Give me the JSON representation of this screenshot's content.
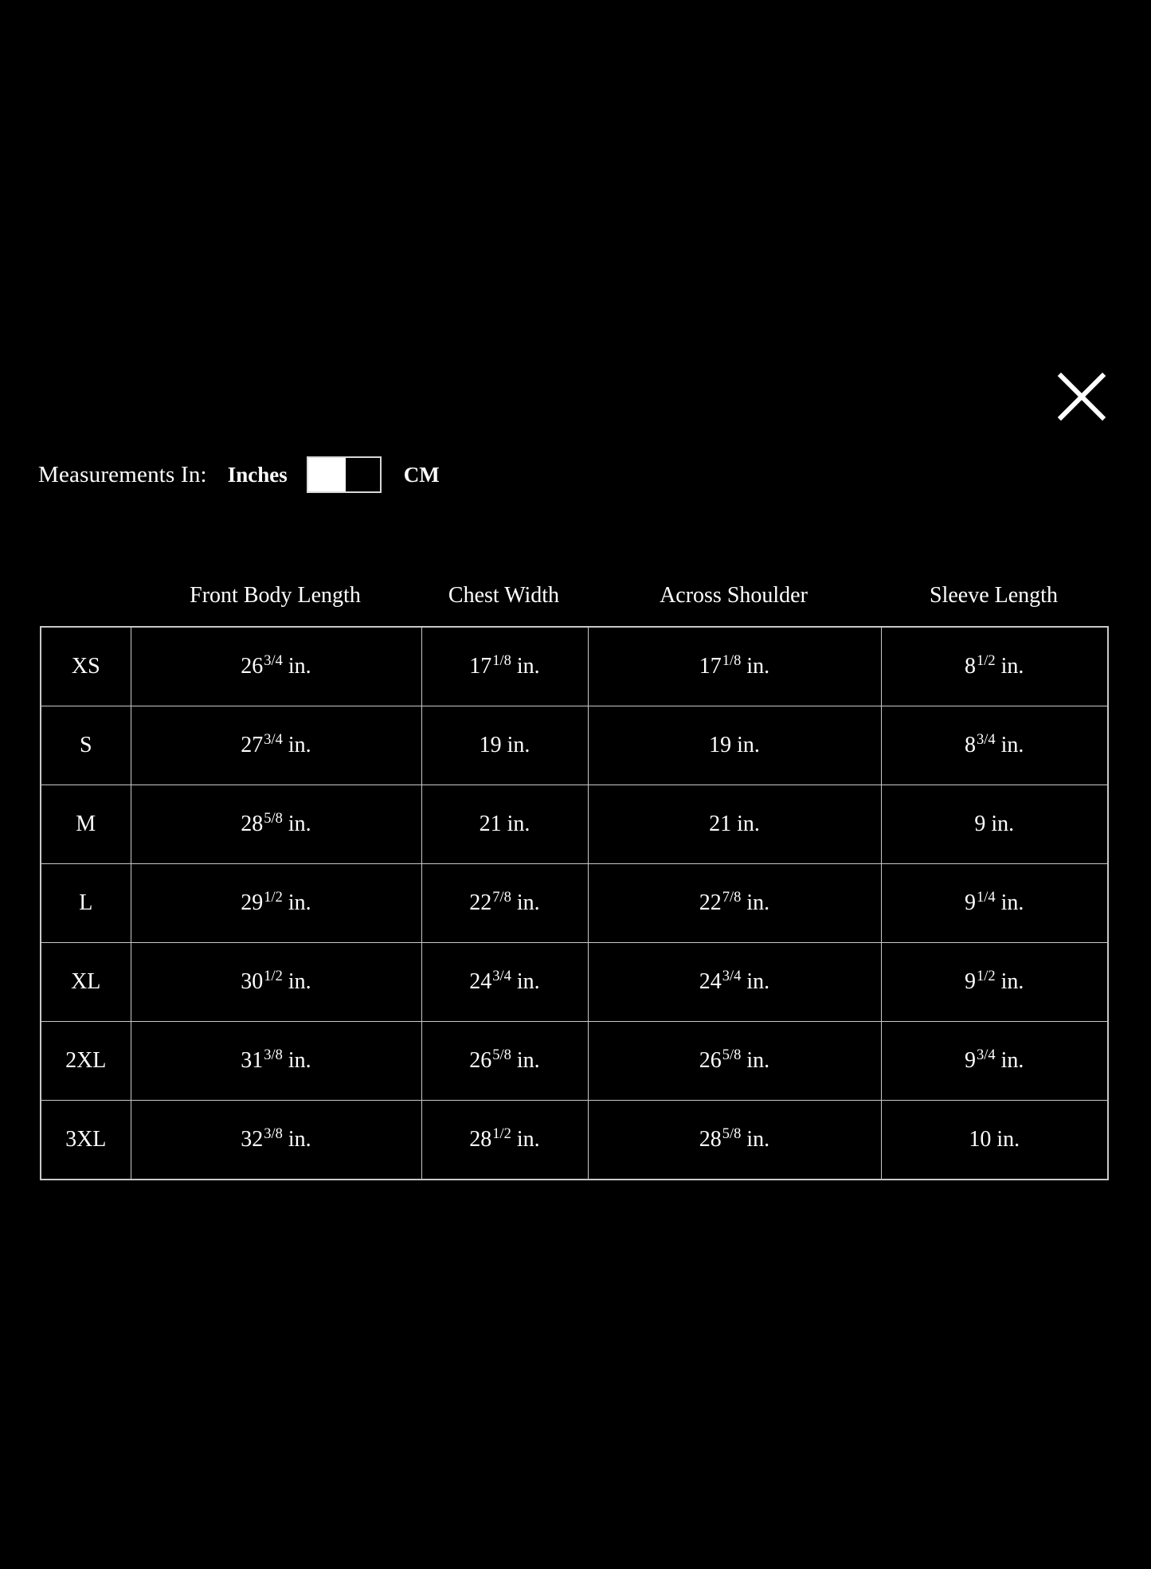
{
  "dialog": {
    "close_icon": "close-icon"
  },
  "units": {
    "label": "Measurements In:",
    "option_inches": "Inches",
    "option_cm": "CM",
    "selected": "Inches",
    "toggle_position": "left"
  },
  "table": {
    "size_column_header": "",
    "columns": [
      "Front Body Length",
      "Chest Width",
      "Across Shoulder",
      "Sleeve Length"
    ],
    "rows": [
      {
        "size": "XS",
        "cells": [
          {
            "whole": "26",
            "fraction": "3/4",
            "unit": "in."
          },
          {
            "whole": "17",
            "fraction": "1/8",
            "unit": "in."
          },
          {
            "whole": "17",
            "fraction": "1/8",
            "unit": "in."
          },
          {
            "whole": "8",
            "fraction": "1/2",
            "unit": "in."
          }
        ]
      },
      {
        "size": "S",
        "cells": [
          {
            "whole": "27",
            "fraction": "3/4",
            "unit": "in."
          },
          {
            "whole": "19",
            "fraction": "",
            "unit": "in."
          },
          {
            "whole": "19",
            "fraction": "",
            "unit": "in."
          },
          {
            "whole": "8",
            "fraction": "3/4",
            "unit": "in."
          }
        ]
      },
      {
        "size": "M",
        "cells": [
          {
            "whole": "28",
            "fraction": "5/8",
            "unit": "in."
          },
          {
            "whole": "21",
            "fraction": "",
            "unit": "in."
          },
          {
            "whole": "21",
            "fraction": "",
            "unit": "in."
          },
          {
            "whole": "9",
            "fraction": "",
            "unit": "in."
          }
        ]
      },
      {
        "size": "L",
        "cells": [
          {
            "whole": "29",
            "fraction": "1/2",
            "unit": "in."
          },
          {
            "whole": "22",
            "fraction": "7/8",
            "unit": "in."
          },
          {
            "whole": "22",
            "fraction": "7/8",
            "unit": "in."
          },
          {
            "whole": "9",
            "fraction": "1/4",
            "unit": "in."
          }
        ]
      },
      {
        "size": "XL",
        "cells": [
          {
            "whole": "30",
            "fraction": "1/2",
            "unit": "in."
          },
          {
            "whole": "24",
            "fraction": "3/4",
            "unit": "in."
          },
          {
            "whole": "24",
            "fraction": "3/4",
            "unit": "in."
          },
          {
            "whole": "9",
            "fraction": "1/2",
            "unit": "in."
          }
        ]
      },
      {
        "size": "2XL",
        "cells": [
          {
            "whole": "31",
            "fraction": "3/8",
            "unit": "in."
          },
          {
            "whole": "26",
            "fraction": "5/8",
            "unit": "in."
          },
          {
            "whole": "26",
            "fraction": "5/8",
            "unit": "in."
          },
          {
            "whole": "9",
            "fraction": "3/4",
            "unit": "in."
          }
        ]
      },
      {
        "size": "3XL",
        "cells": [
          {
            "whole": "32",
            "fraction": "3/8",
            "unit": "in."
          },
          {
            "whole": "28",
            "fraction": "1/2",
            "unit": "in."
          },
          {
            "whole": "28",
            "fraction": "5/8",
            "unit": "in."
          },
          {
            "whole": "10",
            "fraction": "",
            "unit": "in."
          }
        ]
      }
    ]
  },
  "colors": {
    "background": "#000000",
    "text": "#ffffff",
    "border": "#c9c9c9",
    "toggle_knob": "#ffffff"
  }
}
